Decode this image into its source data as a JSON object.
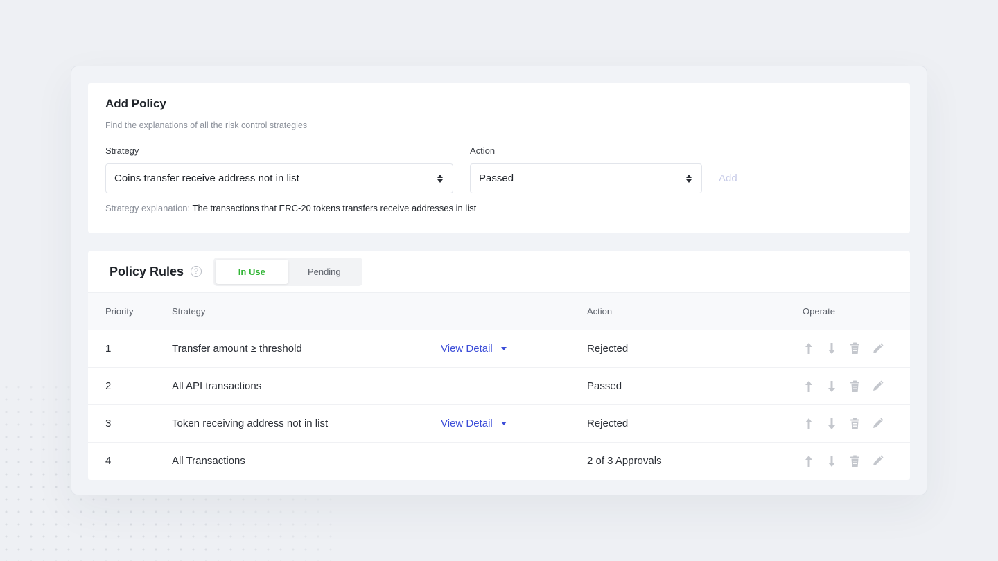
{
  "add_policy": {
    "title": "Add Policy",
    "subtitle": "Find the explanations of all the risk control strategies",
    "strategy_label": "Strategy",
    "strategy_value": "Coins transfer receive address not in list",
    "action_label": "Action",
    "action_value": "Passed",
    "add_label": "Add",
    "explanation_label": "Strategy explanation:",
    "explanation_value": "The transactions that ERC-20 tokens transfers receive addresses in list"
  },
  "policy_rules": {
    "title": "Policy Rules",
    "help_icon": "question-circle-icon",
    "tabs": [
      {
        "label": "In Use",
        "active": true
      },
      {
        "label": "Pending",
        "active": false
      }
    ],
    "columns": {
      "priority": "Priority",
      "strategy": "Strategy",
      "action": "Action",
      "operate": "Operate"
    },
    "view_detail_label": "View Detail",
    "rows": [
      {
        "priority": "1",
        "strategy": "Transfer amount ≥ threshold",
        "has_detail": true,
        "action": "Rejected"
      },
      {
        "priority": "2",
        "strategy": "All API transactions",
        "has_detail": false,
        "action": "Passed"
      },
      {
        "priority": "3",
        "strategy": "Token receiving address not in list",
        "has_detail": true,
        "action": "Rejected"
      },
      {
        "priority": "4",
        "strategy": "All Transactions",
        "has_detail": false,
        "action": "2 of 3 Approvals"
      }
    ],
    "operate_icons": [
      "arrow-up-icon",
      "arrow-down-icon",
      "trash-icon",
      "pencil-icon"
    ]
  },
  "colors": {
    "accent_blue": "#3d4ed8",
    "active_green": "#32b536",
    "disabled_add": "#c7cbe8",
    "icon_gray": "#c4c7cd"
  }
}
